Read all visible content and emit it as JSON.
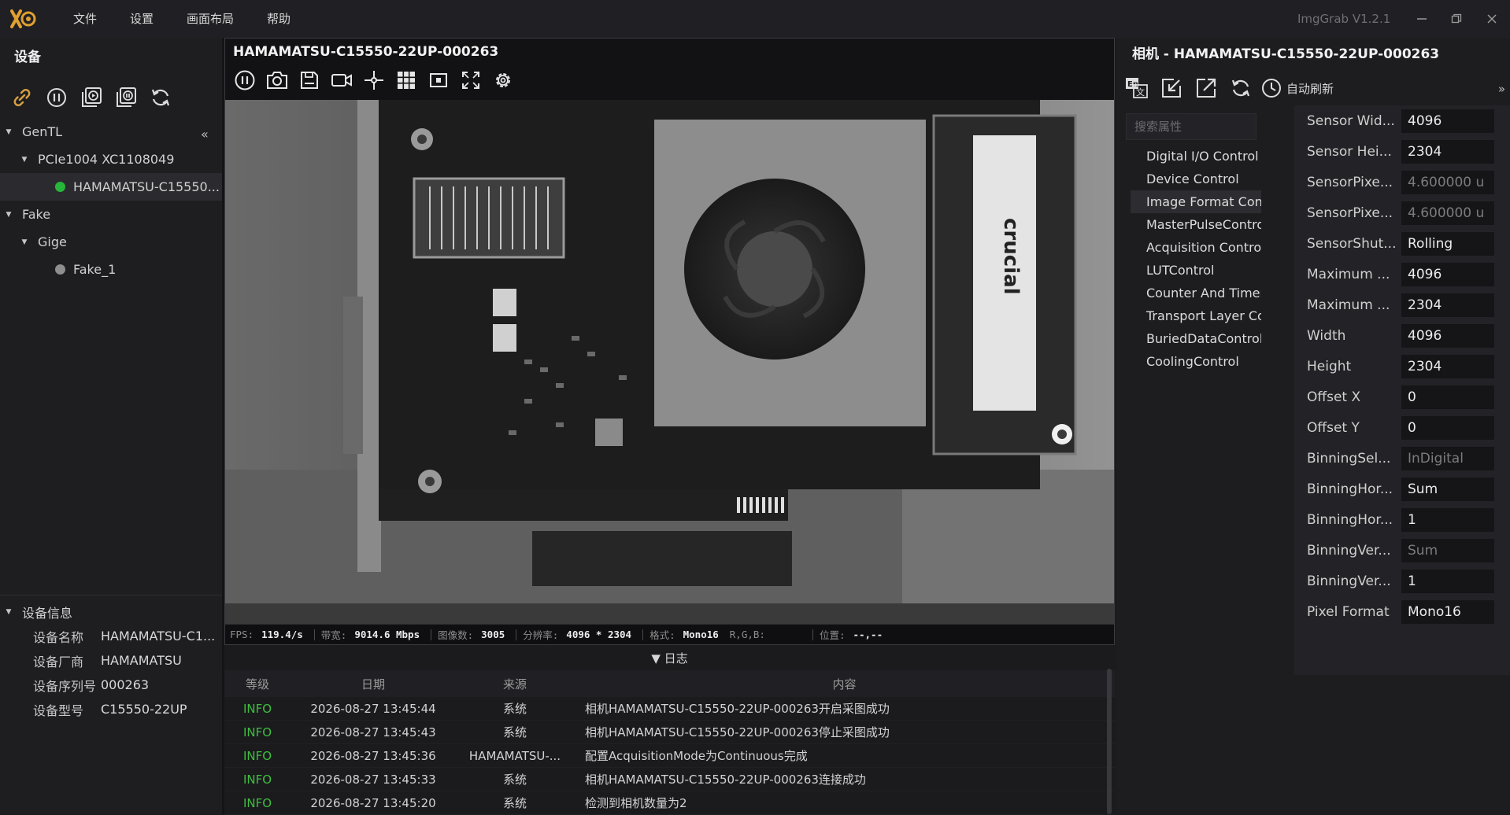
{
  "app": {
    "name": "ImgGrab V1.2.1",
    "menu": [
      "文件",
      "设置",
      "画面布局",
      "帮助"
    ]
  },
  "left_panel": {
    "title": "设备",
    "tree": [
      {
        "label": "GenTL",
        "level": 0,
        "expanded": true
      },
      {
        "label": "PCIe1004 XC1108049",
        "level": 1,
        "expanded": true
      },
      {
        "label": "HAMAMATSU-C15550...",
        "level": 2,
        "status": "#27b53a",
        "selected": true
      },
      {
        "label": "Fake",
        "level": 0,
        "expanded": true
      },
      {
        "label": "Gige",
        "level": 1,
        "expanded": true
      },
      {
        "label": "Fake_1",
        "level": 2,
        "status": "#8e8e8e"
      }
    ],
    "info": {
      "title": "设备信息",
      "rows": [
        {
          "key": "设备名称",
          "value": "HAMAMATSU-C1..."
        },
        {
          "key": "设备厂商",
          "value": "HAMAMATSU"
        },
        {
          "key": "设备序列号",
          "value": "000263"
        },
        {
          "key": "设备型号",
          "value": "C15550-22UP"
        }
      ]
    }
  },
  "viewer": {
    "title": "HAMAMATSU-C15550-22UP-000263",
    "status": {
      "fps_label": "FPS:",
      "fps": "119.4/s",
      "bw_label": "带宽:",
      "bw": "9014.6 Mbps",
      "count_label": "图像数:",
      "count": "3005",
      "res_label": "分辨率:",
      "res": "4096 * 2304",
      "fmt_label": "格式:",
      "fmt": "Mono16",
      "rgb_label": "R,G,B:",
      "pos_label": "位置:",
      "pos": "--,--"
    }
  },
  "log": {
    "toggle": "▼ 日志",
    "headers": [
      "等级",
      "日期",
      "来源",
      "内容"
    ],
    "rows": [
      {
        "level": "INFO",
        "date": "2026-08-27 13:45:44",
        "source": "系统",
        "content": "相机HAMAMATSU-C15550-22UP-000263开启采图成功"
      },
      {
        "level": "INFO",
        "date": "2026-08-27 13:45:43",
        "source": "系统",
        "content": "相机HAMAMATSU-C15550-22UP-000263停止采图成功"
      },
      {
        "level": "INFO",
        "date": "2026-08-27 13:45:36",
        "source": "HAMAMATSU-...",
        "content": "配置AcquisitionMode为Continuous完成"
      },
      {
        "level": "INFO",
        "date": "2026-08-27 13:45:33",
        "source": "系统",
        "content": "相机HAMAMATSU-C15550-22UP-000263连接成功"
      },
      {
        "level": "INFO",
        "date": "2026-08-27 13:45:20",
        "source": "系统",
        "content": "检测到相机数量为2"
      }
    ]
  },
  "right_panel": {
    "title": "相机 - HAMAMATSU-C15550-22UP-000263",
    "auto_refresh": "自动刷新",
    "search_placeholder": "搜索属性",
    "categories": [
      "Digital I/O Control",
      "Device Control",
      "Image Format Control",
      "MasterPulseControl",
      "Acquisition Control",
      "LUTControl",
      "Counter And Timer Cor",
      "Transport Layer Contro",
      "BuriedDataControl",
      "CoolingControl"
    ],
    "selected_category": 2,
    "properties": [
      {
        "key": "Sensor Wid...",
        "value": "4096"
      },
      {
        "key": "Sensor Hei...",
        "value": "2304"
      },
      {
        "key": "SensorPixe...",
        "value": "4.600000 u",
        "readonly": true
      },
      {
        "key": "SensorPixe...",
        "value": "4.600000 u",
        "readonly": true
      },
      {
        "key": "SensorShut...",
        "value": "Rolling"
      },
      {
        "key": "Maximum ...",
        "value": "4096"
      },
      {
        "key": "Maximum ...",
        "value": "2304"
      },
      {
        "key": "Width",
        "value": "4096"
      },
      {
        "key": "Height",
        "value": "2304"
      },
      {
        "key": "Offset X",
        "value": "0"
      },
      {
        "key": "Offset Y",
        "value": "0"
      },
      {
        "key": "BinningSel...",
        "value": "InDigital",
        "readonly": true
      },
      {
        "key": "BinningHor...",
        "value": "Sum"
      },
      {
        "key": "BinningHor...",
        "value": "1"
      },
      {
        "key": "BinningVer...",
        "value": "Sum",
        "readonly": true
      },
      {
        "key": "BinningVer...",
        "value": "1"
      },
      {
        "key": "Pixel Format",
        "value": "Mono16"
      }
    ]
  },
  "colors": {
    "accent_green": "#27b53a",
    "logo_gold": "#e0a030",
    "link_icon": "#d8a040"
  }
}
